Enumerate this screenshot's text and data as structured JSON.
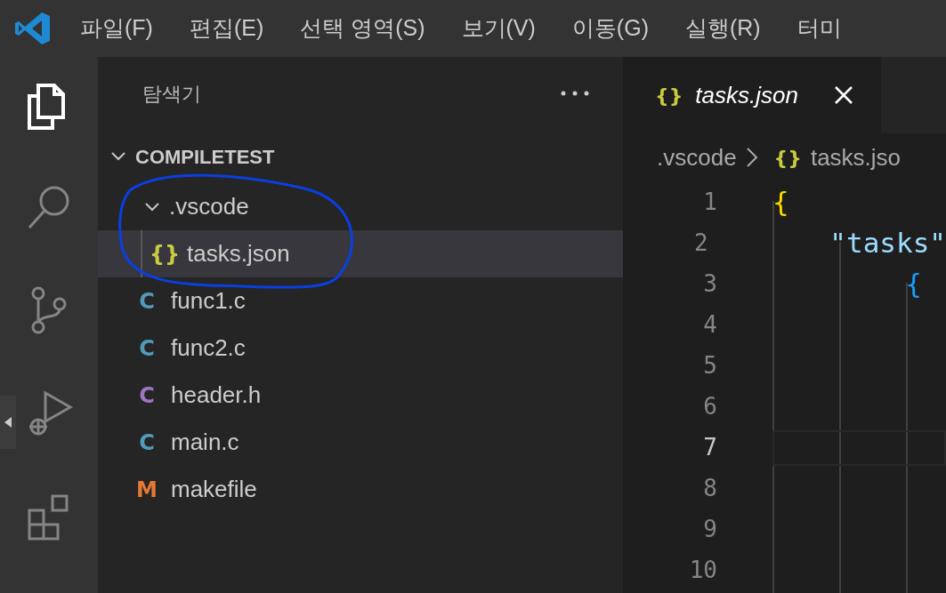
{
  "menu": [
    "파일(F)",
    "편집(E)",
    "선택 영역(S)",
    "보기(V)",
    "이동(G)",
    "실행(R)",
    "터미"
  ],
  "activity_bar": [
    {
      "kind": "explorer",
      "selected": true
    },
    {
      "kind": "search",
      "selected": false
    },
    {
      "kind": "source-control",
      "selected": false
    },
    {
      "kind": "run",
      "selected": false
    },
    {
      "kind": "extensions",
      "selected": false
    }
  ],
  "sidebar": {
    "title": "탐색기",
    "section": {
      "label": "COMPILETEST",
      "expanded": true
    },
    "tree": [
      {
        "name": ".vscode",
        "kind": "folder",
        "expanded": true,
        "selected": false,
        "children": [
          {
            "name": "tasks.json",
            "kind": "file",
            "icon": "{}",
            "color": "#cbcb41",
            "selected": true
          }
        ]
      },
      {
        "name": "func1.c",
        "kind": "file",
        "icon": "C",
        "color": "#519aba",
        "selected": false
      },
      {
        "name": "func2.c",
        "kind": "file",
        "icon": "C",
        "color": "#519aba",
        "selected": false
      },
      {
        "name": "header.h",
        "kind": "file",
        "icon": "C",
        "color": "#a074c4",
        "selected": false
      },
      {
        "name": "main.c",
        "kind": "file",
        "icon": "C",
        "color": "#519aba",
        "selected": false
      },
      {
        "name": "makefile",
        "kind": "file",
        "icon": "M",
        "color": "#e37933",
        "selected": false
      }
    ]
  },
  "editor": {
    "tab": {
      "icon": "{}",
      "title": "tasks.json",
      "preview": true
    },
    "breadcrumb": {
      "folder": ".vscode",
      "icon": "{}",
      "file": "tasks.jso"
    },
    "lines": [
      {
        "number": "1",
        "text": "{",
        "color": "#ffd700",
        "current": false
      },
      {
        "number": "2",
        "text": "    \"tasks\"",
        "color": "#9cdcfe",
        "current": false
      },
      {
        "number": "3",
        "text": "        {",
        "color": "#179fff",
        "current": false
      },
      {
        "number": "4",
        "current": false
      },
      {
        "number": "5",
        "current": false
      },
      {
        "number": "6",
        "current": false
      },
      {
        "number": "7",
        "current": true
      },
      {
        "number": "8",
        "current": false
      },
      {
        "number": "9",
        "current": false
      },
      {
        "number": "10",
        "current": false
      }
    ]
  }
}
